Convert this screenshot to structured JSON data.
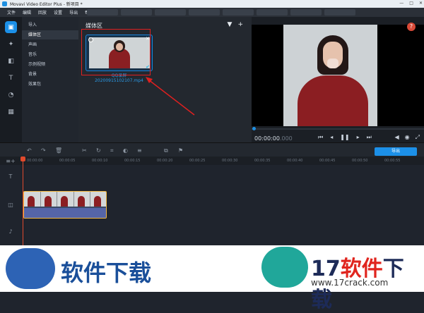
{
  "window": {
    "title": "Movavi Video Editor Plus - 新项目 *",
    "controls": [
      "—",
      "□",
      "✕"
    ]
  },
  "menu": [
    "文件",
    "编辑",
    "回放",
    "设置",
    "导出",
    "帮助"
  ],
  "categories": [
    "导入",
    "媒体区",
    "声画",
    "音乐",
    "示例视频",
    "背景",
    "效果包"
  ],
  "media_panel": {
    "title": "媒体区",
    "filter_icon": "▼",
    "add_icon": "+",
    "clip_caption_line1": "QQ录屏",
    "clip_caption_line2": "20200915102107.mp4"
  },
  "preview": {
    "timecode": "00:00:00",
    "timecode_ms": ".000",
    "help": "?"
  },
  "toolbar": {
    "export_label": "导出"
  },
  "ruler": [
    "00:00:00",
    "00:00:05",
    "00:00:10",
    "00:00:15",
    "00:00:20",
    "00:00:25",
    "00:00:30",
    "00:00:35",
    "00:00:40",
    "00:00:45",
    "00:00:50",
    "00:00:55"
  ],
  "watermark": {
    "left": "软件下载",
    "right_num": "17",
    "right_red": "软件",
    "right_tail": "下载",
    "url": "www.17crack.com"
  }
}
